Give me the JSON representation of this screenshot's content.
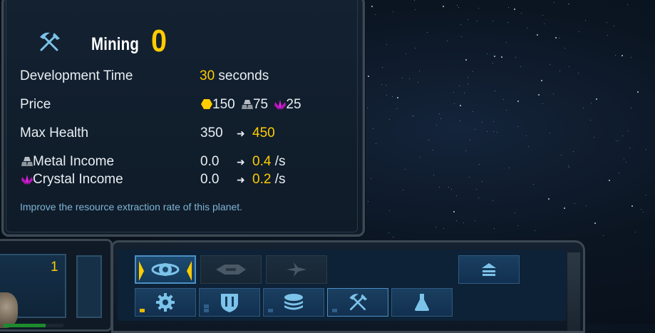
{
  "tooltip": {
    "title": "Mining",
    "level": "0",
    "rows": {
      "dev_time": {
        "label": "Development Time",
        "value": "30",
        "unit": "seconds"
      },
      "price": {
        "label": "Price",
        "gold": "150",
        "metal": "75",
        "crystal": "25"
      },
      "max_health": {
        "label": "Max Health",
        "current": "350",
        "next": "450"
      },
      "metal_income": {
        "label": "Metal Income",
        "current": "0.0",
        "next": "0.4",
        "unit": "/s"
      },
      "crystal_income": {
        "label": "Crystal Income",
        "current": "0.0",
        "next": "0.2",
        "unit": "/s"
      }
    },
    "description": "Improve the resource extraction rate of this planet."
  },
  "planet_card": {
    "count": "1",
    "health_fraction": 0.7
  },
  "action_bar": {
    "row1": [
      {
        "icon": "planet-core-icon",
        "state": "selected"
      },
      {
        "icon": "ship-cruiser-icon",
        "state": "disabled"
      },
      {
        "icon": "ship-fighter-icon",
        "state": "disabled"
      },
      {
        "icon": "layers-up-icon",
        "state": "normal"
      }
    ],
    "row2": [
      {
        "icon": "gear-icon",
        "state": "normal"
      },
      {
        "icon": "shield-icon",
        "state": "normal"
      },
      {
        "icon": "stack-icon",
        "state": "normal"
      },
      {
        "icon": "mining-tools-icon",
        "state": "highlighted"
      },
      {
        "icon": "flask-icon",
        "state": "normal"
      }
    ]
  },
  "colors": {
    "accent_yellow": "#ffcc00",
    "crystal_magenta": "#e01ee0",
    "description_blue": "#7fb4d6"
  }
}
